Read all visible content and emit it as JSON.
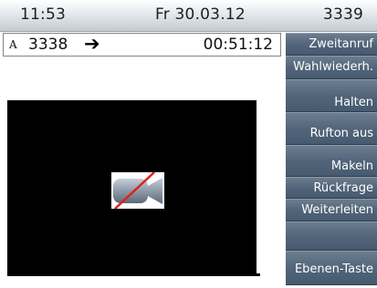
{
  "statusbar": {
    "time": "11:53",
    "date": "Fr 30.03.12",
    "extension": "3339"
  },
  "call": {
    "line_indicator": "A",
    "number": "3338",
    "direction_glyph": "➔",
    "duration": "00:51:12"
  },
  "softkeys": [
    {
      "label": "Zweitanruf"
    },
    {
      "label": "Wahlwiederh."
    },
    {
      "label": "Halten"
    },
    {
      "label": "Rufton aus"
    },
    {
      "label": "Makeln"
    },
    {
      "label": "Rückfrage"
    },
    {
      "label": "Weiterleiten"
    },
    {
      "label": ""
    },
    {
      "label": "Ebenen-Taste"
    }
  ],
  "video": {
    "camera_icon": "camera-off-icon",
    "accent_color": "#e02020"
  }
}
